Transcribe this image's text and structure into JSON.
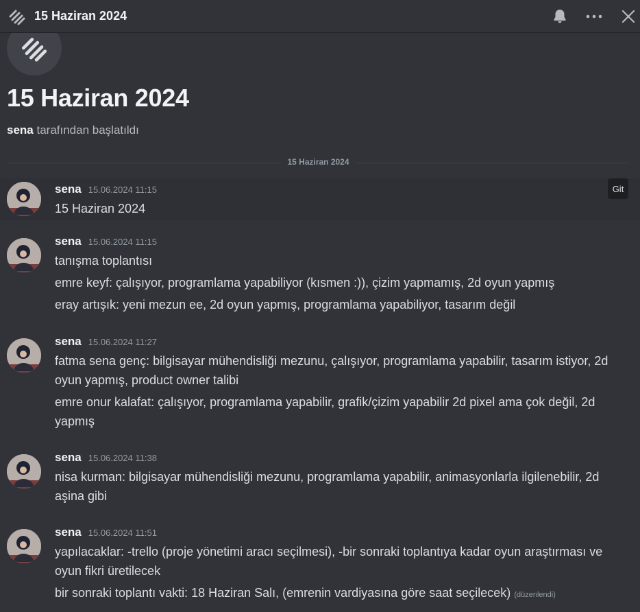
{
  "header": {
    "title": "15 Haziran 2024",
    "icons": [
      "thread-icon",
      "bell-icon",
      "more-icon",
      "close-icon"
    ]
  },
  "thread": {
    "title": "15 Haziran 2024",
    "started_by_user": "sena",
    "started_by_suffix": "tarafından başlatıldı",
    "date_divider": "15 Haziran 2024"
  },
  "hover_tooltip": "Git",
  "messages": [
    {
      "author": "sena",
      "time": "15.06.2024 11:15",
      "lines": [
        "15 Haziran 2024"
      ]
    },
    {
      "author": "sena",
      "time": "15.06.2024 11:15",
      "lines": [
        "tanışma toplantısı",
        "emre keyf: çalışıyor, programlama yapabiliyor (kısmen :)), çizim yapmamış, 2d oyun yapmış",
        "eray artışık: yeni mezun ee, 2d oyun yapmış, programlama yapabiliyor, tasarım değil"
      ]
    },
    {
      "author": "sena",
      "time": "15.06.2024 11:27",
      "lines": [
        "fatma sena genç: bilgisayar mühendisliği mezunu, çalışıyor, programlama yapabilir, tasarım istiyor, 2d oyun yapmış, product owner talibi",
        "emre onur kalafat: çalışıyor, programlama yapabilir, grafik/çizim yapabilir 2d pixel ama çok değil, 2d yapmış"
      ]
    },
    {
      "author": "sena",
      "time": "15.06.2024 11:38",
      "lines": [
        "nisa kurman: bilgisayar mühendisliği mezunu, programlama yapabilir, animasyonlarla ilgilenebilir, 2d aşina gibi"
      ]
    },
    {
      "author": "sena",
      "time": "15.06.2024 11:51",
      "lines": [
        "yapılacaklar: -trello (proje yönetimi aracı seçilmesi), -bir sonraki toplantıya kadar oyun araştırması ve oyun fikri üretilecek",
        "bir sonraki toplantı vakti: 18 Haziran Salı, (emrenin vardiyasına göre saat seçilecek)"
      ],
      "edited_label": "(düzenlendi)"
    }
  ],
  "colors": {
    "background": "#313338",
    "header_border": "#232428",
    "text": "#dbdee1",
    "muted": "#949ba4",
    "hover_row": "#2e3035"
  }
}
